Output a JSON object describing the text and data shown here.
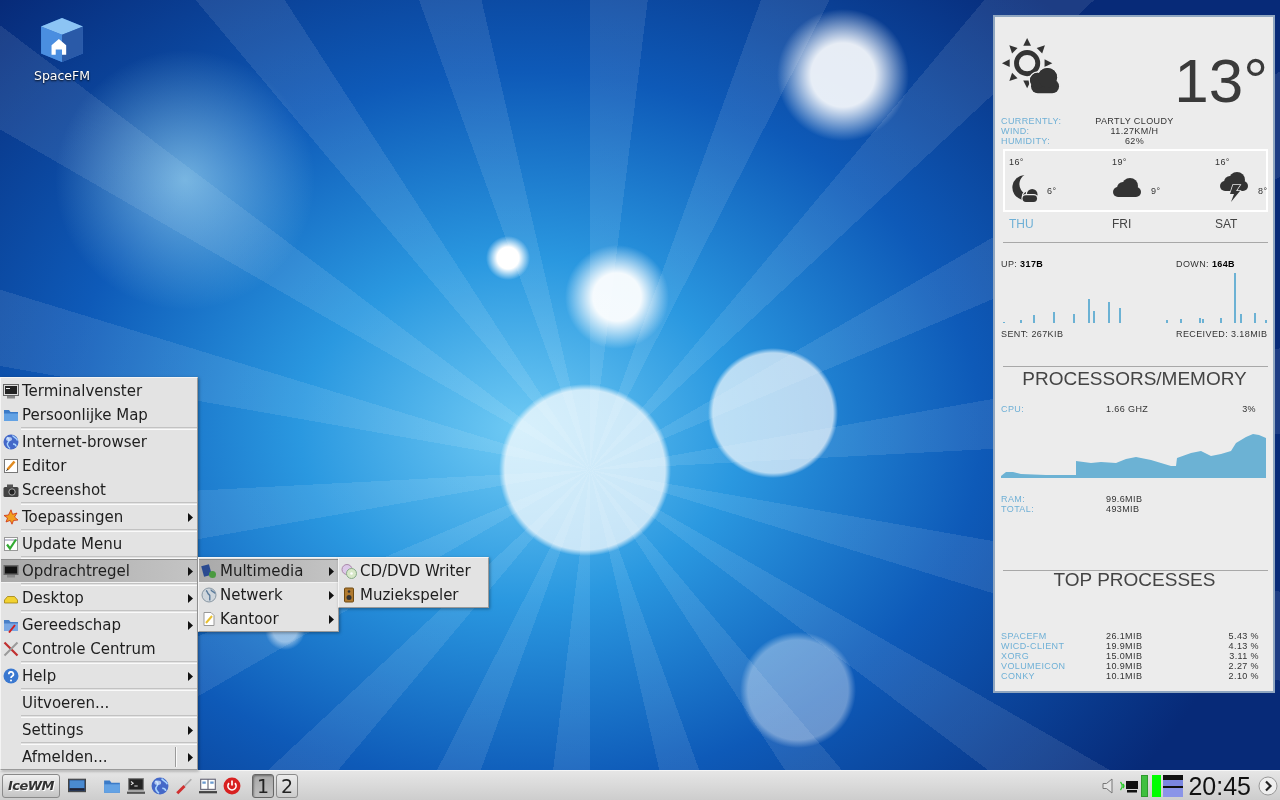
{
  "desktop_icons": [
    {
      "label": "SpaceFM"
    }
  ],
  "start_menu": {
    "sections": [
      {
        "items": [
          {
            "label": "Terminalvenster",
            "has_submenu": false,
            "selected": false
          },
          {
            "label": "Persoonlijke Map",
            "has_submenu": false,
            "selected": false
          }
        ]
      },
      {
        "items": [
          {
            "label": "Internet-browser",
            "has_submenu": false,
            "selected": false
          },
          {
            "label": "Editor",
            "has_submenu": false,
            "selected": false
          },
          {
            "label": "Screenshot",
            "has_submenu": false,
            "selected": false
          }
        ]
      },
      {
        "items": [
          {
            "label": "Toepassingen",
            "has_submenu": true,
            "selected": false
          }
        ]
      },
      {
        "items": [
          {
            "label": "Update Menu",
            "has_submenu": false,
            "selected": false
          }
        ]
      },
      {
        "items": [
          {
            "label": "Opdrachtregel",
            "has_submenu": true,
            "selected": true
          }
        ]
      },
      {
        "items": [
          {
            "label": "Desktop",
            "has_submenu": true,
            "selected": false
          }
        ]
      },
      {
        "items": [
          {
            "label": "Gereedschap",
            "has_submenu": true,
            "selected": false
          },
          {
            "label": "Controle Centrum",
            "has_submenu": false,
            "selected": false
          }
        ]
      },
      {
        "items": [
          {
            "label": "Help",
            "has_submenu": true,
            "selected": false
          }
        ]
      },
      {
        "items": [
          {
            "label": "Uitvoeren...",
            "has_submenu": false,
            "selected": false
          }
        ]
      },
      {
        "items": [
          {
            "label": "Settings",
            "has_submenu": true,
            "selected": false
          }
        ]
      },
      {
        "items": [
          {
            "label": "Afmelden...",
            "has_submenu": true,
            "selected": false
          }
        ]
      }
    ]
  },
  "submenus": [
    {
      "items": [
        {
          "label": "Multimedia",
          "has_submenu": true,
          "selected": true
        },
        {
          "label": "Netwerk",
          "has_submenu": true,
          "selected": false
        },
        {
          "label": "Kantoor",
          "has_submenu": true,
          "selected": false
        }
      ]
    },
    {
      "items": [
        {
          "label": "CD/DVD Writer",
          "has_submenu": false,
          "selected": false
        },
        {
          "label": "Muziekspeler",
          "has_submenu": false,
          "selected": false
        }
      ]
    }
  ],
  "conky": {
    "weather": {
      "temperature": "13°",
      "details": [
        {
          "label": "CURRENTLY:",
          "value": "PARTLY CLOUDY"
        },
        {
          "label": "WIND:",
          "value": "11.27KM/H"
        },
        {
          "label": "HUMIDITY:",
          "value": "62%"
        }
      ],
      "forecast": [
        {
          "day": "THU",
          "high": "16°",
          "low": "6°",
          "today": true
        },
        {
          "day": "FRI",
          "high": "19°",
          "low": "9°",
          "today": false
        },
        {
          "day": "SAT",
          "high": "16°",
          "low": "8°",
          "today": false
        }
      ]
    },
    "network": {
      "up": "UP: **317B**",
      "down": "DOWN: **164B**",
      "sent": "SENT: 267KIB",
      "received": "RECEIVED: 3.18MIB"
    },
    "system": {
      "heading": "PROCESSORS/MEMORY",
      "cpu_label": "CPU:",
      "cpu_frequency": "1.66 GHZ",
      "cpu_usage": "3%",
      "memory": [
        {
          "label": "RAM:",
          "value": "99.6MIB"
        },
        {
          "label": "TOTAL:",
          "value": "493MIB"
        }
      ]
    },
    "top_processes": {
      "heading": "TOP PROCESSES",
      "rows": [
        {
          "name": "SPACEFM",
          "memory": "26.1MIB",
          "cpu": "5.43 %"
        },
        {
          "name": "WICD-CLIENT",
          "memory": "19.9MIB",
          "cpu": "4.13 %"
        },
        {
          "name": "XORG",
          "memory": "15.0MIB",
          "cpu": "3.11 %"
        },
        {
          "name": "VOLUMEICON",
          "memory": "10.9MIB",
          "cpu": "2.27 %"
        },
        {
          "name": "CONKY",
          "memory": "10.1MIB",
          "cpu": "2.10 %"
        }
      ]
    }
  },
  "taskbar": {
    "start_button": {
      "label": "IceWM"
    },
    "workspaces": [
      {
        "label": "1",
        "selected": true
      },
      {
        "label": "2",
        "selected": false
      }
    ],
    "clock": "20:45"
  }
}
